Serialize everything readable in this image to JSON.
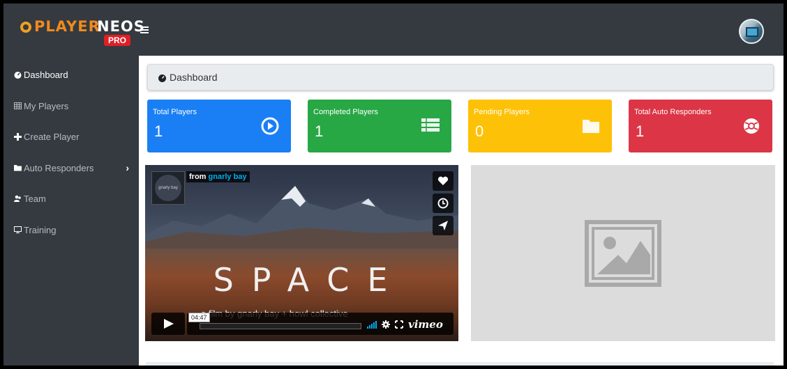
{
  "app": {
    "logo_main": "PLAYER",
    "logo_second": "NEOS",
    "logo_badge": "PRO"
  },
  "sidebar": {
    "items": [
      {
        "label": "Dashboard",
        "icon": "tachometer-icon",
        "active": true
      },
      {
        "label": "My Players",
        "icon": "table-icon",
        "active": false
      },
      {
        "label": "Create Player",
        "icon": "plus-icon",
        "active": false
      },
      {
        "label": "Auto Responders",
        "icon": "folder-icon",
        "active": false,
        "has_submenu": true
      },
      {
        "label": "Team",
        "icon": "users-icon",
        "active": false
      },
      {
        "label": "Training",
        "icon": "desktop-icon",
        "active": false
      }
    ]
  },
  "breadcrumb": {
    "label": "Dashboard",
    "icon": "tachometer-icon"
  },
  "stats": [
    {
      "title": "Total Players",
      "count": "1",
      "color": "#1a7ff5",
      "icon": "play-circle-icon"
    },
    {
      "title": "Completed Players",
      "count": "1",
      "color": "#28a745",
      "icon": "list-icon"
    },
    {
      "title": "Pending Players",
      "count": "0",
      "color": "#fdc107",
      "icon": "folder-icon"
    },
    {
      "title": "Total Auto Responders",
      "count": "1",
      "color": "#dc3545",
      "icon": "life-ring-icon"
    }
  ],
  "video": {
    "channel_badge": "gnarly bay",
    "from_prefix": "from",
    "from_channel": "gnarly bay",
    "title_overlay": "SPACE",
    "caption": "a film by gnarly bay + howl collective",
    "time": "04:47",
    "brand": "vimeo",
    "side_buttons": [
      "heart-icon",
      "clock-icon",
      "send-icon"
    ]
  },
  "media_placeholder": {
    "icon": "image-icon"
  }
}
